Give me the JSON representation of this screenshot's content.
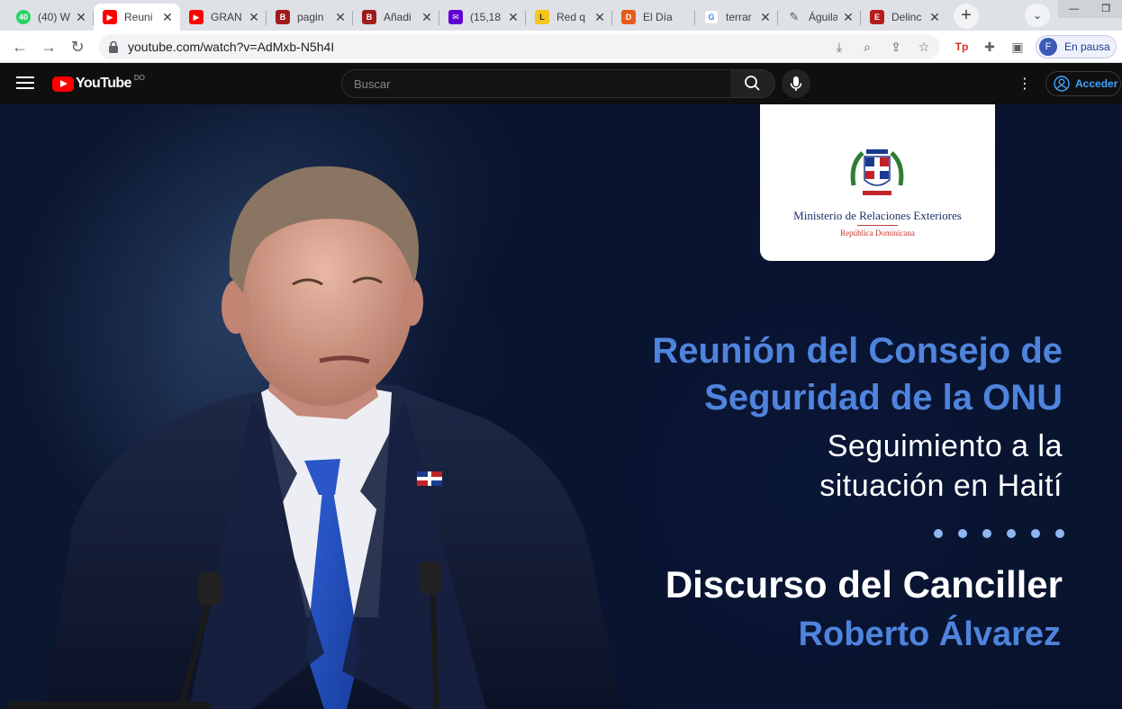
{
  "browser": {
    "tabs": [
      {
        "title": "(40) W",
        "favicon": "whatsapp-icon",
        "color": "#25d366",
        "badge": "40"
      },
      {
        "title": "Reuni",
        "favicon": "youtube-icon",
        "color": "#ff0000",
        "active": true
      },
      {
        "title": "GRAN",
        "favicon": "youtube-icon",
        "color": "#ff0000"
      },
      {
        "title": "pagin",
        "favicon": "blogger-icon",
        "color": "#a01c1c"
      },
      {
        "title": "Añadi",
        "favicon": "blogger-icon",
        "color": "#a01c1c"
      },
      {
        "title": "(15,18",
        "favicon": "mail-icon",
        "color": "#6001d2"
      },
      {
        "title": "Red q",
        "favicon": "newspaper-icon",
        "color": "#f5c518"
      },
      {
        "title": "El Día",
        "favicon": "eldia-icon",
        "color": "#e85a1b"
      },
      {
        "title": "terrar",
        "favicon": "google-icon",
        "color": "#4285f4"
      },
      {
        "title": "Águila",
        "favicon": "feather-icon",
        "color": "#555555"
      },
      {
        "title": "Delinc",
        "favicon": "news-icon",
        "color": "#b71c1c"
      }
    ],
    "url": "youtube.com/watch?v=AdMxb-N5h4I",
    "profile": {
      "initial": "F",
      "label": "En pausa"
    }
  },
  "youtube": {
    "logo_text": "YouTube",
    "country_code": "DO",
    "search_placeholder": "Buscar",
    "signin_label": "Acceder"
  },
  "video": {
    "org_name": "Ministerio de Relaciones Exteriores",
    "org_country": "República Dominicana",
    "headline_line1": "Reunión del Consejo de",
    "headline_line2": "Seguridad de la ONU",
    "subtitle_line1": "Seguimiento a la",
    "subtitle_line2": "situación en Haití",
    "speech_title": "Discurso del Canciller",
    "speaker_name": "Roberto Álvarez",
    "accent_color": "#4f84dd"
  }
}
